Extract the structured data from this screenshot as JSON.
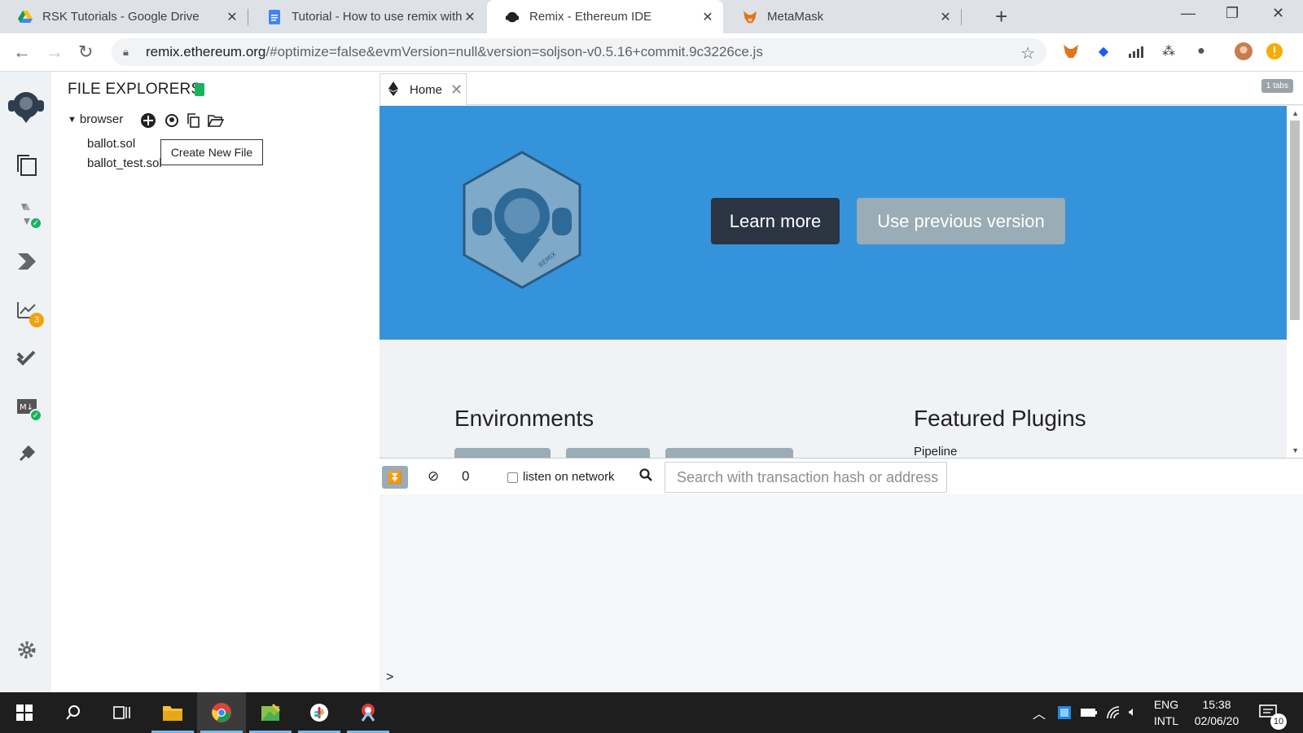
{
  "browser": {
    "tabs": [
      {
        "title": "RSK Tutorials - Google Drive",
        "icon": "google-drive-icon"
      },
      {
        "title": "Tutorial - How to use remix with",
        "icon": "google-docs-icon"
      },
      {
        "title": "Remix - Ethereum IDE",
        "icon": "remix-icon",
        "active": true
      },
      {
        "title": "MetaMask",
        "icon": "metamask-icon"
      }
    ],
    "new_tab": "+",
    "url_host": "remix.ethereum.org",
    "url_rest": "/#optimize=false&evmVersion=null&version=soljson-v0.5.16+commit.9c3226ce.js"
  },
  "remix": {
    "side_panel": {
      "title": "FILE EXPLORERS",
      "root_folder": "browser",
      "files": [
        "ballot.sol",
        "ballot_test.sol"
      ],
      "tooltip": "Create New File"
    },
    "icon_panel": {
      "analysis_badge": "3"
    },
    "main": {
      "home_tab_label": "Home",
      "tabs_count": "1 tabs",
      "learn_more": "Learn more",
      "use_previous": "Use previous version",
      "environments_title": "Environments",
      "featured_title": "Featured Plugins",
      "featured_first": "Pipeline",
      "logo_text": "REMIX"
    },
    "terminal": {
      "pending_count": "0",
      "listen_label": "listen on network",
      "search_placeholder": "Search with transaction hash or address",
      "prompt": ">"
    }
  },
  "taskbar": {
    "language": "ENG",
    "layout": "INTL",
    "time": "15:38",
    "date": "02/06/20",
    "notifications": "10"
  },
  "colors": {
    "hero": "#3593db",
    "learn_more_bg": "#2a3443",
    "secondary_btn": "#9aacb5",
    "success": "#1bb15f",
    "warning": "#f0a30a"
  }
}
